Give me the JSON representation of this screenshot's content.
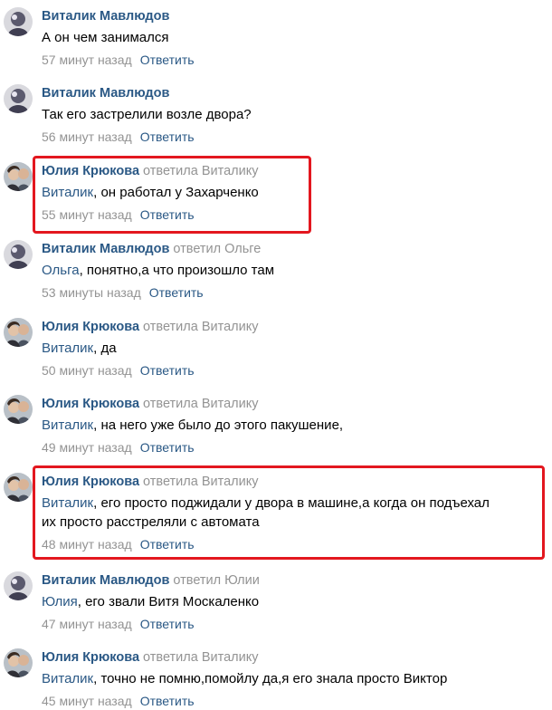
{
  "comments": [
    {
      "author": "Виталик Мавлюдов",
      "replied": "",
      "mention": "",
      "text": "А он чем занимался",
      "text2": "",
      "time": "57 минут назад",
      "reply": "Ответить"
    },
    {
      "author": "Виталик Мавлюдов",
      "replied": "",
      "mention": "",
      "text": "Так его застрелили возле двора?",
      "text2": "",
      "time": "56 минут назад",
      "reply": "Ответить"
    },
    {
      "author": "Юлия Крюкова",
      "replied": "ответила Виталику",
      "mention": "Виталик",
      "text": ", он работал у Захарченко",
      "text2": "",
      "time": "55 минут назад",
      "reply": "Ответить"
    },
    {
      "author": "Виталик Мавлюдов",
      "replied": "ответил Ольге",
      "mention": "Ольга",
      "text": ", понятно,а что произошло там",
      "text2": "",
      "time": "53 минуты назад",
      "reply": "Ответить"
    },
    {
      "author": "Юлия Крюкова",
      "replied": "ответила Виталику",
      "mention": "Виталик",
      "text": ", да",
      "text2": "",
      "time": "50 минут назад",
      "reply": "Ответить"
    },
    {
      "author": "Юлия Крюкова",
      "replied": "ответила Виталику",
      "mention": "Виталик",
      "text": ", на него уже было до этого пакушение,",
      "text2": "",
      "time": "49 минут назад",
      "reply": "Ответить"
    },
    {
      "author": "Юлия Крюкова",
      "replied": "ответила Виталику",
      "mention": "Виталик",
      "text": ", его просто поджидали у двора в машине,а когда он подъехал",
      "text2": "их просто расстреляли с автомата",
      "time": "48 минут назад",
      "reply": "Ответить"
    },
    {
      "author": "Виталик Мавлюдов",
      "replied": "ответил Юлии",
      "mention": "Юлия",
      "text": ", его звали Витя Москаленко",
      "text2": "",
      "time": "47 минут назад",
      "reply": "Ответить"
    },
    {
      "author": "Юлия Крюкова",
      "replied": "ответила Виталику",
      "mention": "Виталик",
      "text": ", точно не помню,помойлу да,я его знала просто Виктор",
      "text2": "",
      "time": "45 минут назад",
      "reply": "Ответить"
    }
  ],
  "colors": {
    "link": "#2a5885",
    "meta": "#939393",
    "highlight": "#e3171f"
  }
}
